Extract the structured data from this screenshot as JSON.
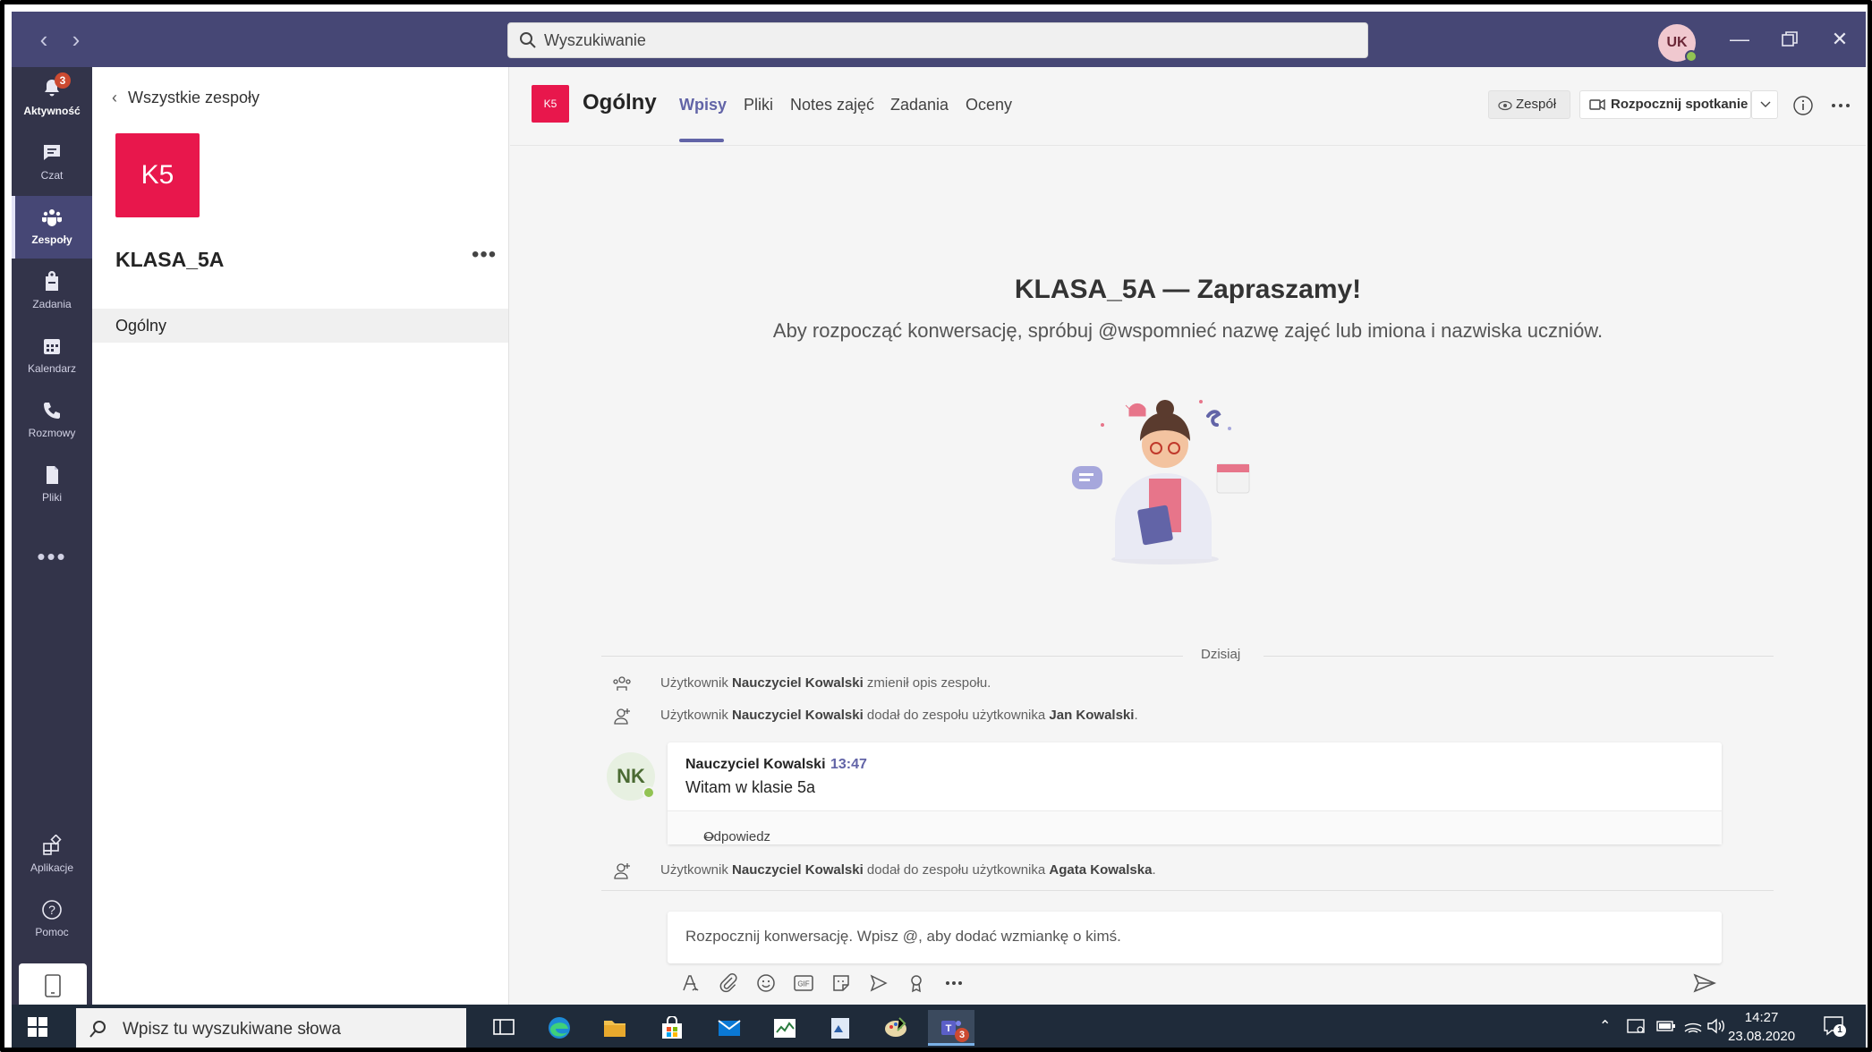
{
  "titlebar": {
    "search_placeholder": "Wyszukiwanie",
    "user_initials": "UK",
    "back_icon": "chevron-left-icon",
    "forward_icon": "chevron-right-icon"
  },
  "rail": {
    "items": [
      {
        "label": "Aktywność",
        "icon": "bell-icon",
        "badge": "3"
      },
      {
        "label": "Czat",
        "icon": "chat-icon"
      },
      {
        "label": "Zespoły",
        "icon": "teams-icon",
        "active": true
      },
      {
        "label": "Zadania",
        "icon": "assignments-icon"
      },
      {
        "label": "Kalendarz",
        "icon": "calendar-icon"
      },
      {
        "label": "Rozmowy",
        "icon": "phone-icon"
      },
      {
        "label": "Pliki",
        "icon": "files-icon"
      }
    ],
    "more": "•••",
    "bottom": [
      {
        "label": "Aplikacje",
        "icon": "apps-icon"
      },
      {
        "label": "Pomoc",
        "icon": "help-icon"
      }
    ]
  },
  "team_panel": {
    "back_label": "Wszystkie zespoły",
    "team_tile": "K5",
    "team_name": "KLASA_5A",
    "more": "•••",
    "channel": "Ogólny"
  },
  "channel_header": {
    "tile": "K5",
    "name": "Ogólny",
    "tabs": [
      "Wpisy",
      "Pliki",
      "Notes zajęć",
      "Zadania",
      "Oceny"
    ],
    "team_button": "Zespół",
    "meet_button": "Rozpocznij spotkanie"
  },
  "welcome": {
    "title": "KLASA_5A — Zapraszamy!",
    "subtitle": "Aby rozpocząć konwersację, spróbuj @wspomnieć nazwę zajęć lub imiona i nazwiska uczniów."
  },
  "feed": {
    "date_divider": "Dzisiaj",
    "events": [
      {
        "pre": "Użytkownik ",
        "actor": "Nauczyciel Kowalski",
        "mid": " zmienił opis zespołu.",
        "target": "",
        "post": ""
      },
      {
        "pre": "Użytkownik ",
        "actor": "Nauczyciel Kowalski",
        "mid": " dodał do zespołu użytkownika ",
        "target": "Jan Kowalski",
        "post": "."
      },
      {
        "pre": "Użytkownik ",
        "actor": "Nauczyciel Kowalski",
        "mid": " dodał do zespołu użytkownika ",
        "target": "Agata Kowalska",
        "post": "."
      }
    ],
    "message": {
      "avatar": "NK",
      "author": "Nauczyciel Kowalski",
      "time": "13:47",
      "text": "Witam w klasie 5a",
      "reply": "Odpowiedz"
    }
  },
  "compose": {
    "placeholder": "Rozpocznij konwersację. Wpisz @, aby dodać wzmiankę o kimś.",
    "tools": [
      "format-icon",
      "attach-icon",
      "emoji-icon",
      "gif-icon",
      "sticker-icon",
      "meet-now-icon",
      "praise-icon",
      "more-icon"
    ]
  },
  "taskbar": {
    "search_placeholder": "Wpisz tu wyszukiwane słowa",
    "time": "14:27",
    "date": "23.08.2020",
    "notifications": "1",
    "teams_badge": "3"
  },
  "colors": {
    "titlebar": "#464775",
    "rail": "#33344a",
    "accent": "#6264a7",
    "team_tile": "#e8174c",
    "taskbar": "#1f2b3a"
  }
}
